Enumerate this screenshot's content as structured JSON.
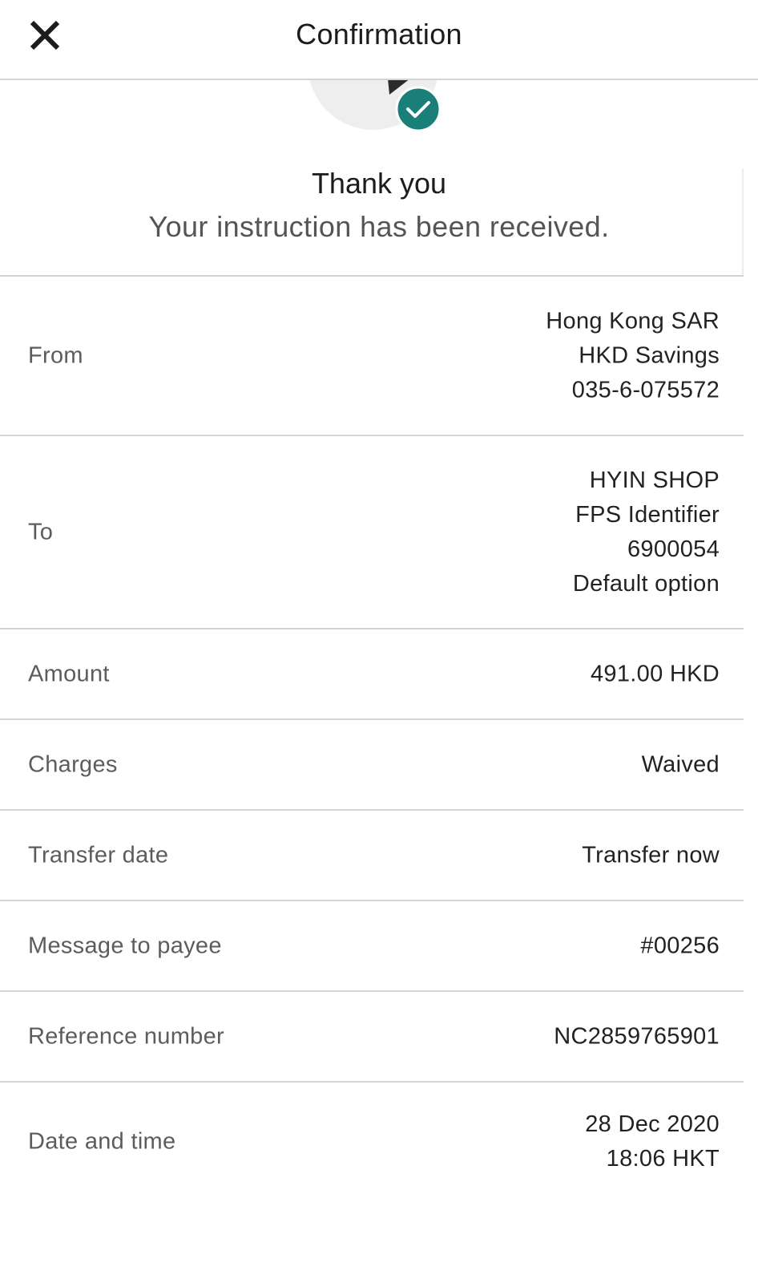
{
  "header": {
    "title": "Confirmation",
    "close_icon": "close-icon"
  },
  "status": {
    "icon": "transfer-success-icon",
    "title": "Thank you",
    "message": "Your instruction has been received."
  },
  "colors": {
    "accent": "#1a7f78",
    "divider": "#d4d4d4",
    "label": "#5c5c5c"
  },
  "details": {
    "from": {
      "label": "From",
      "lines": [
        "Hong Kong SAR",
        "HKD Savings",
        "035-6-075572"
      ]
    },
    "to": {
      "label": "To",
      "lines": [
        "HYIN SHOP",
        "FPS Identifier",
        "6900054",
        "Default option"
      ]
    },
    "amount": {
      "label": "Amount",
      "value": "491.00 HKD"
    },
    "charges": {
      "label": "Charges",
      "value": "Waived"
    },
    "transfer_date": {
      "label": "Transfer date",
      "value": "Transfer now"
    },
    "message": {
      "label": "Message to payee",
      "value": "#00256"
    },
    "reference": {
      "label": "Reference number",
      "value": "NC2859765901"
    },
    "datetime": {
      "label": "Date and time",
      "lines": [
        "28 Dec 2020",
        "18:06 HKT"
      ]
    }
  }
}
